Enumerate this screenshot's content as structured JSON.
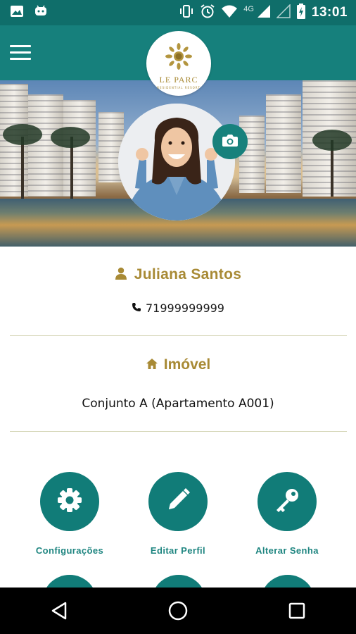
{
  "status_bar": {
    "time": "13:01",
    "network": "4G",
    "left_icons": [
      "image-icon",
      "android-icon"
    ],
    "right_icons": [
      "vibrate-icon",
      "alarm-icon",
      "wifi-icon",
      "signal-icon",
      "signal-empty-icon",
      "battery-charging-icon"
    ]
  },
  "app_bar": {
    "menu_icon": "hamburger-menu-icon",
    "logo": {
      "name": "LE PARC",
      "subtitle": "RESIDENTIAL RESORT"
    }
  },
  "profile": {
    "camera_icon": "camera-icon",
    "name": "Juliana Santos",
    "name_icon": "user-icon",
    "phone": "71999999999",
    "phone_icon": "phone-icon"
  },
  "property": {
    "title": "Imóvel",
    "title_icon": "home-icon",
    "unit": "Conjunto A (Apartamento A001)"
  },
  "actions": [
    {
      "label": "Configurações",
      "icon": "gear-icon"
    },
    {
      "label": "Editar Perfil",
      "icon": "pencil-icon"
    },
    {
      "label": "Alterar Senha",
      "icon": "key-icon"
    }
  ],
  "nav_bar": [
    "back-icon",
    "home-circle-icon",
    "recents-icon"
  ],
  "colors": {
    "status_bar": "#0f6e6a",
    "app_bar": "#16807c",
    "accent_gold": "#a88a35",
    "action_teal": "#117c78",
    "action_label": "#1e8580",
    "divider": "#d7d8bb"
  }
}
